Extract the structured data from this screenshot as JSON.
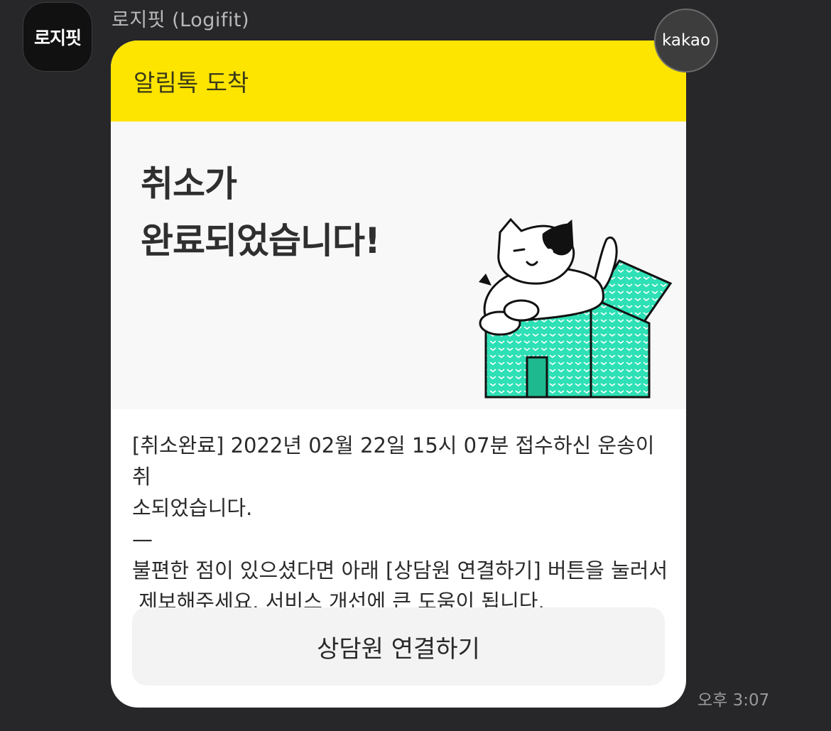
{
  "sender": {
    "avatar_text": "로지핏",
    "name": "로지핏 (Logifit)"
  },
  "badge": {
    "label": "kakao"
  },
  "message": {
    "header": "알림톡 도착",
    "hero_title_line1": "취소가",
    "hero_title_line2": "완료되었습니다!",
    "body_lines": [
      "[취소완료] 2022년 02월 22일 15시 07분 접수하신 운송이 취",
      "소되었습니다.",
      "—",
      "불편한 점이 있으셨다면 아래 [상담원 연결하기] 버튼을 눌러서",
      " 제보해주세요. 서비스 개선에 큰 도움이 됩니다."
    ],
    "button_label": "상담원 연결하기"
  },
  "timestamp": "오후 3:07",
  "colors": {
    "header_yellow": "#fee500",
    "box_teal": "#2ee0b5",
    "background": "#27272a"
  }
}
